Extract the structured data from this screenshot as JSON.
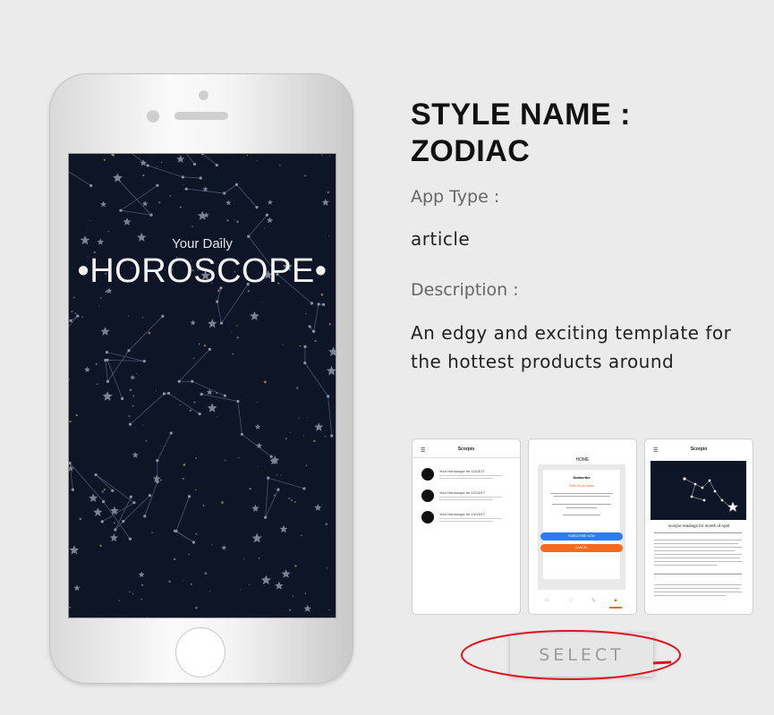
{
  "phone": {
    "screen_subtitle": "Your Daily",
    "screen_title": "•HOROSCOPE•"
  },
  "style": {
    "title": "STYLE NAME : ZODIAC",
    "app_type_label": "App Type :",
    "app_type_value": "article",
    "description_label": "Description :",
    "description_value": "An edgy and exciting template for the hottest products around"
  },
  "thumbnails": {
    "list": {
      "header": "Scorpio",
      "items": [
        "Your Horoscope for 11/13/17",
        "Your Horoscope for 12/13/17",
        "Your Horoscope for 13/13/17"
      ]
    },
    "subscribe": {
      "header": "HOME",
      "card_title": "Subscribe",
      "price": "₹499.00 per week",
      "subscribe_button": "SUBSCRIBE NOW",
      "cancel_button": "CANCEL"
    },
    "article": {
      "header": "Scorpio",
      "caption": "scorpio readings for month of April"
    }
  },
  "select_button": "SELECT",
  "colors": {
    "screen_bg": "#0d1526",
    "subscribe_blue": "#2d7cf3",
    "cancel_orange": "#f46a1f",
    "highlight_red": "#e0141e"
  }
}
